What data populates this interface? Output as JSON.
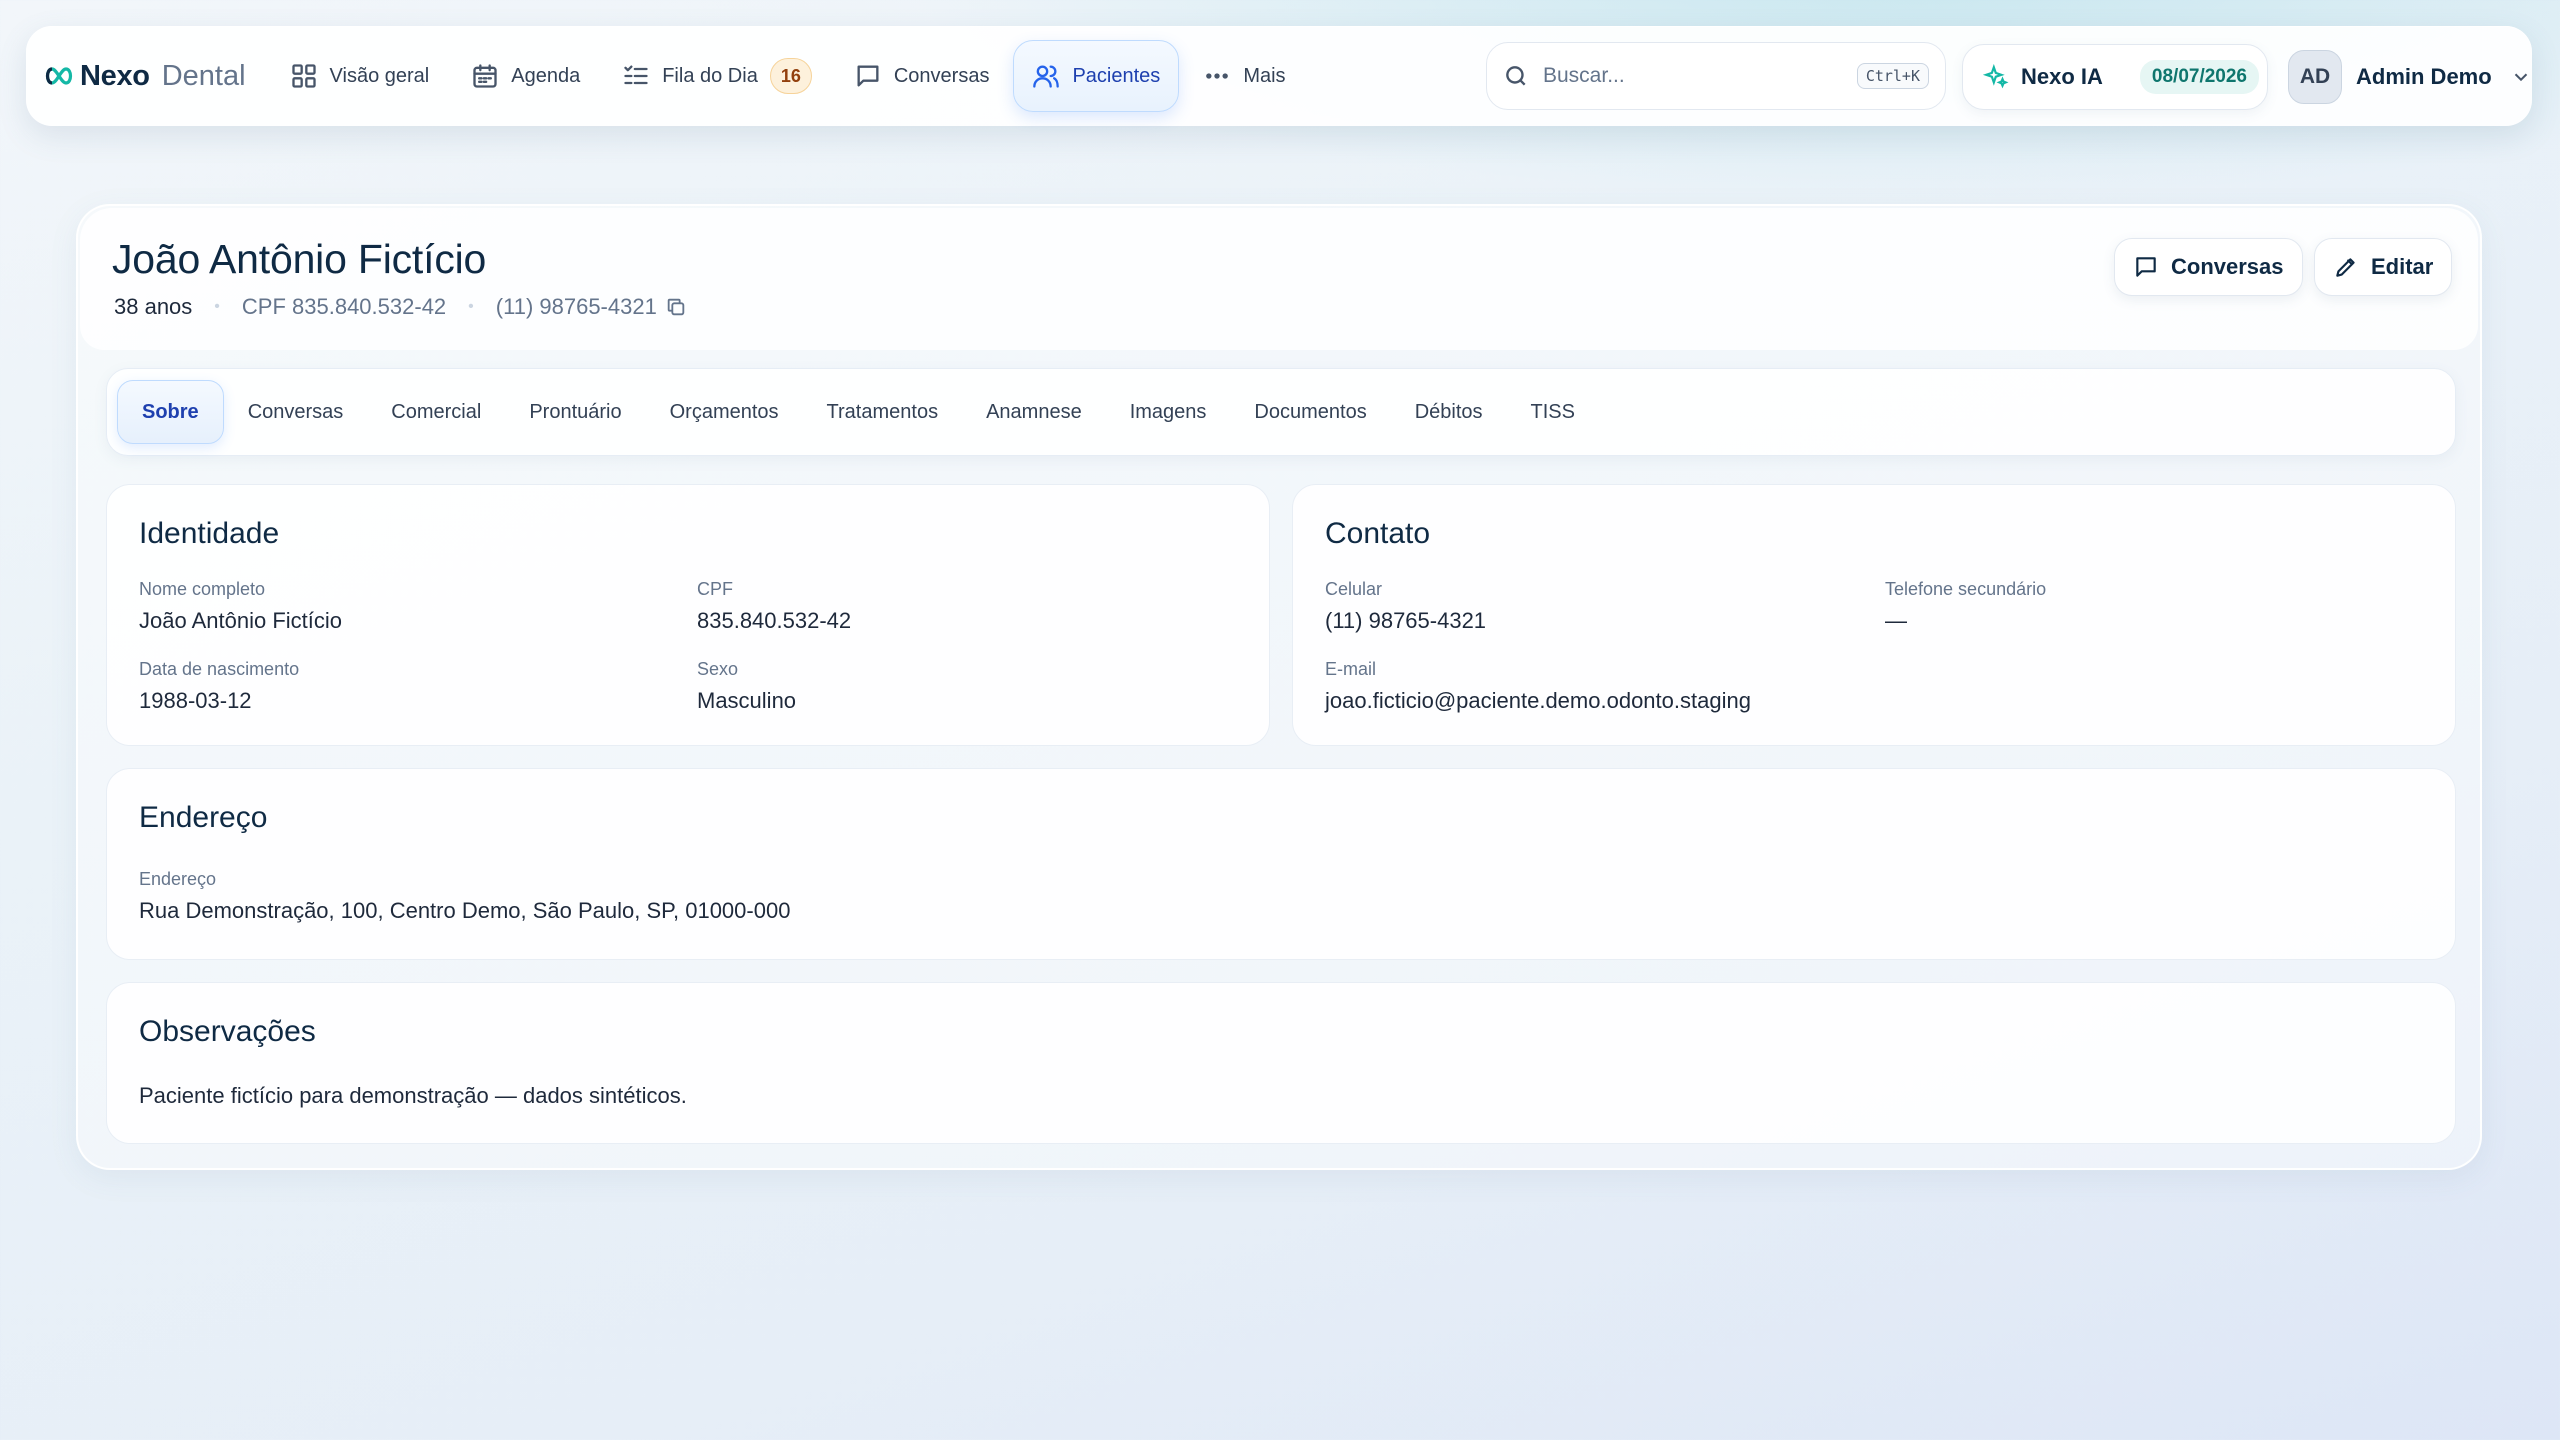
{
  "brand": {
    "name": "Nexo",
    "sub": "Dental"
  },
  "nav": {
    "items": [
      {
        "label": "Visão geral"
      },
      {
        "label": "Agenda"
      },
      {
        "label": "Fila do Dia",
        "badge": "16"
      },
      {
        "label": "Conversas"
      },
      {
        "label": "Pacientes"
      },
      {
        "label": "Mais"
      }
    ]
  },
  "search": {
    "placeholder": "Buscar...",
    "shortcut": "Ctrl+K"
  },
  "ia": {
    "label": "Nexo IA",
    "date": "08/07/2026"
  },
  "user": {
    "initials": "AD",
    "name": "Admin Demo"
  },
  "patient": {
    "name": "João Antônio Fictício",
    "age": "38 anos",
    "cpf_meta": "CPF 835.840.532-42",
    "phone_meta": "(11) 98765-4321"
  },
  "header_buttons": {
    "conversas": "Conversas",
    "editar": "Editar"
  },
  "tabs": [
    "Sobre",
    "Conversas",
    "Comercial",
    "Prontuário",
    "Orçamentos",
    "Tratamentos",
    "Anamnese",
    "Imagens",
    "Documentos",
    "Débitos",
    "TISS"
  ],
  "identidade": {
    "title": "Identidade",
    "nome_label": "Nome completo",
    "nome": "João Antônio Fictício",
    "cpf_label": "CPF",
    "cpf": "835.840.532-42",
    "nasc_label": "Data de nascimento",
    "nasc": "1988-03-12",
    "sexo_label": "Sexo",
    "sexo": "Masculino"
  },
  "contato": {
    "title": "Contato",
    "celular_label": "Celular",
    "celular": "(11) 98765-4321",
    "tel2_label": "Telefone secundário",
    "tel2": "—",
    "email_label": "E-mail",
    "email": "joao.ficticio@paciente.demo.odonto.staging"
  },
  "endereco": {
    "title": "Endereço",
    "label": "Endereço",
    "value": "Rua Demonstração, 100, Centro Demo, São Paulo, SP, 01000-000"
  },
  "observacoes": {
    "title": "Observações",
    "text": "Paciente fictício para demonstração — dados sintéticos."
  },
  "colors": {
    "accent": "#2563eb",
    "teal": "#14b8a6",
    "badge_bg": "#fdf1dc"
  }
}
